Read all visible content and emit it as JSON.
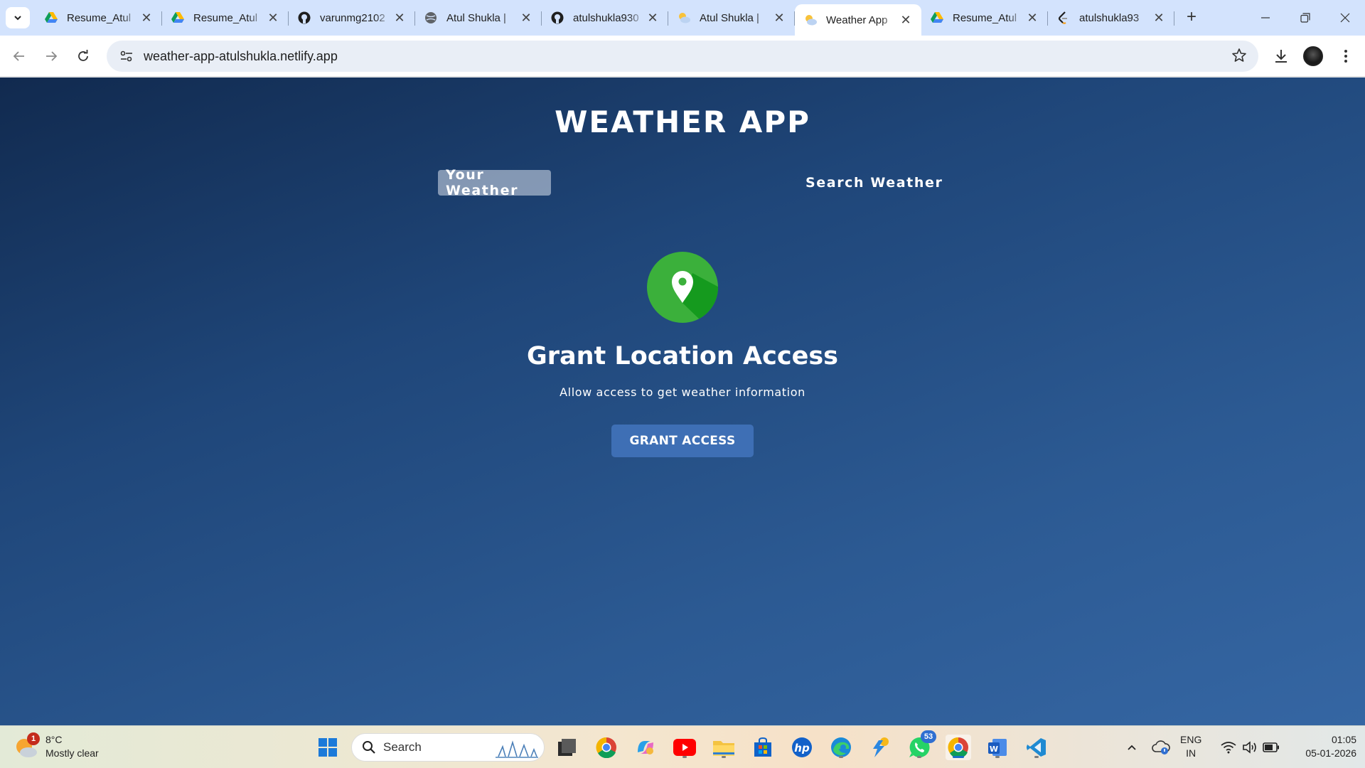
{
  "browser": {
    "tabs": [
      {
        "title": "Resume_Atul",
        "favicon": "google-drive-icon",
        "active": false
      },
      {
        "title": "Resume_Atul",
        "favicon": "google-drive-icon",
        "active": false
      },
      {
        "title": "varunmg2102",
        "favicon": "github-icon",
        "active": false
      },
      {
        "title": "Atul Shukla |",
        "favicon": "globe-icon",
        "active": false
      },
      {
        "title": "atulshukla930",
        "favicon": "github-icon",
        "active": false
      },
      {
        "title": "Atul Shukla |",
        "favicon": "weather-icon",
        "active": false
      },
      {
        "title": "Weather App",
        "favicon": "weather-icon",
        "active": true
      },
      {
        "title": "Resume_Atul",
        "favicon": "google-drive-icon",
        "active": false
      },
      {
        "title": "atulshukla93",
        "favicon": "leetcode-icon",
        "active": false
      }
    ],
    "url": "weather-app-atulshukla.netlify.app"
  },
  "app": {
    "title": "WEATHER APP",
    "tab_your_weather": "Your Weather",
    "tab_search_weather": "Search Weather",
    "grant_title": "Grant Location Access",
    "grant_subtitle": "Allow access to get weather information",
    "grant_button": "GRANT ACCESS",
    "colors": {
      "background": "#1f4679",
      "accent": "#3e6fb5",
      "pin_green": "#3bb03b"
    }
  },
  "taskbar": {
    "weather": {
      "temp": "8°C",
      "condition": "Mostly clear",
      "badge": "1"
    },
    "search_placeholder": "Search",
    "whatsapp_badge": "53",
    "language": {
      "line1": "ENG",
      "line2": "IN"
    },
    "time": "01:05",
    "date": "05-01-2026"
  }
}
